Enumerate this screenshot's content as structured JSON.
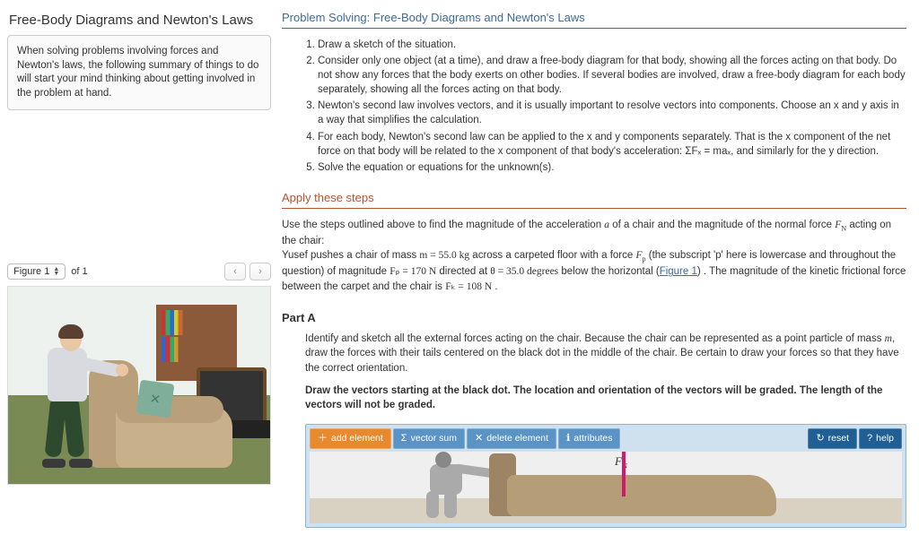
{
  "page": {
    "title": "Free-Body Diagrams and Newton's Laws"
  },
  "intro": {
    "text": "When solving problems involving forces and Newton's laws, the following summary of things to do will start your mind thinking about getting involved in the problem at hand."
  },
  "problemSolving": {
    "heading": "Problem Solving: Free-Body Diagrams and Newton's Laws",
    "steps": [
      "Draw a sketch of the situation.",
      "Consider only one object (at a time), and draw a free-body diagram for that body, showing all the forces acting on that body. Do not show any forces that the body exerts on other bodies. If several bodies are involved, draw a free-body diagram for each body separately, showing all the forces acting on that body.",
      "Newton's second law involves vectors, and it is usually important to resolve vectors into components. Choose an x and y axis in a way that simplifies the calculation.",
      "For each body, Newton's second law can be applied to the x and y components separately. That is the x component of the net force on that body will be related to the x component of that body's acceleration: ΣFₓ = maₓ, and similarly for the y direction.",
      "Solve the equation or equations for the unknown(s)."
    ]
  },
  "apply": {
    "heading": "Apply these steps",
    "p1_a": "Use the steps outlined above to find the magnitude of the acceleration ",
    "var_a": "a",
    "p1_b": " of a chair and the magnitude of the normal force ",
    "var_FN": "F",
    "sub_N": "N",
    "p1_c": " acting on the chair:",
    "p2_a": "Yusef pushes a chair of mass ",
    "mass_expr": "m = 55.0 kg",
    "p2_b": " across a carpeted floor with a force ",
    "var_Fp": "F",
    "sub_p": "p",
    "p2_c": " (the subscript 'p' here is lowercase and throughout the question) of magnitude ",
    "Fp_expr": "Fₚ = 170 N",
    "p2_d": " directed at ",
    "theta_expr": "θ = 35.0 degrees",
    "p2_e": " below the horizontal (",
    "figlink": "Figure 1",
    "p2_f": ") . The magnitude of the kinetic frictional force between the carpet and the chair is ",
    "Fk_expr": "Fₖ = 108 N",
    "p2_g": " ."
  },
  "figurePanel": {
    "selectLabel": "Figure 1",
    "ofText": "of 1"
  },
  "partA": {
    "title": "Part A",
    "p1_a": "Identify and sketch all the external forces acting on the chair. Because the chair can be represented as a point particle of mass ",
    "var_m": "m",
    "p1_b": ", draw the forces with their tails centered on the black dot in the middle of the chair. Be certain to draw your forces so that they have the correct orientation.",
    "p2": "Draw the vectors starting at the black dot. The location and orientation of the vectors will be graded. The length of the vectors will not be graded.",
    "toolbar": {
      "add": "add element",
      "sum": "vector sum",
      "del": "delete element",
      "attr": "attributes",
      "reset": "reset",
      "help": "help"
    },
    "vectorLabel": {
      "sym": "F",
      "sub": "N"
    }
  }
}
